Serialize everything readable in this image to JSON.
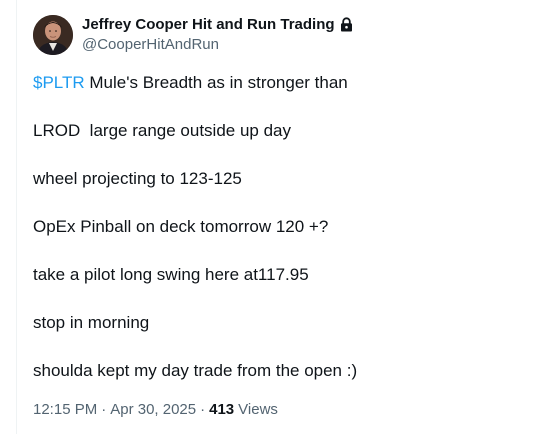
{
  "author": {
    "display_name": "Jeffrey Cooper Hit and Run Trading",
    "handle": "@CooperHitAndRun",
    "protected_icon": "lock-icon",
    "avatar_icon": "avatar"
  },
  "tweet": {
    "cashtag": "$PLTR",
    "first_line_rest": " Mule's Breadth as in stronger than",
    "lines": [
      "LROD  large range outside up day",
      "wheel projecting to 123-125",
      "OpEx Pinball on deck tomorrow 120 +?",
      "take a pilot long swing here at117.95",
      "stop in morning",
      "shoulda kept my day trade from the open :)"
    ]
  },
  "meta": {
    "time": "12:15 PM",
    "separator": "·",
    "date": "Apr 30, 2025",
    "separator2": "·",
    "views_count": "413",
    "views_label": "Views"
  },
  "colors": {
    "text_primary": "#0f1419",
    "text_secondary": "#536471",
    "accent_link": "#1d9bf0",
    "divider": "#eff3f4"
  }
}
